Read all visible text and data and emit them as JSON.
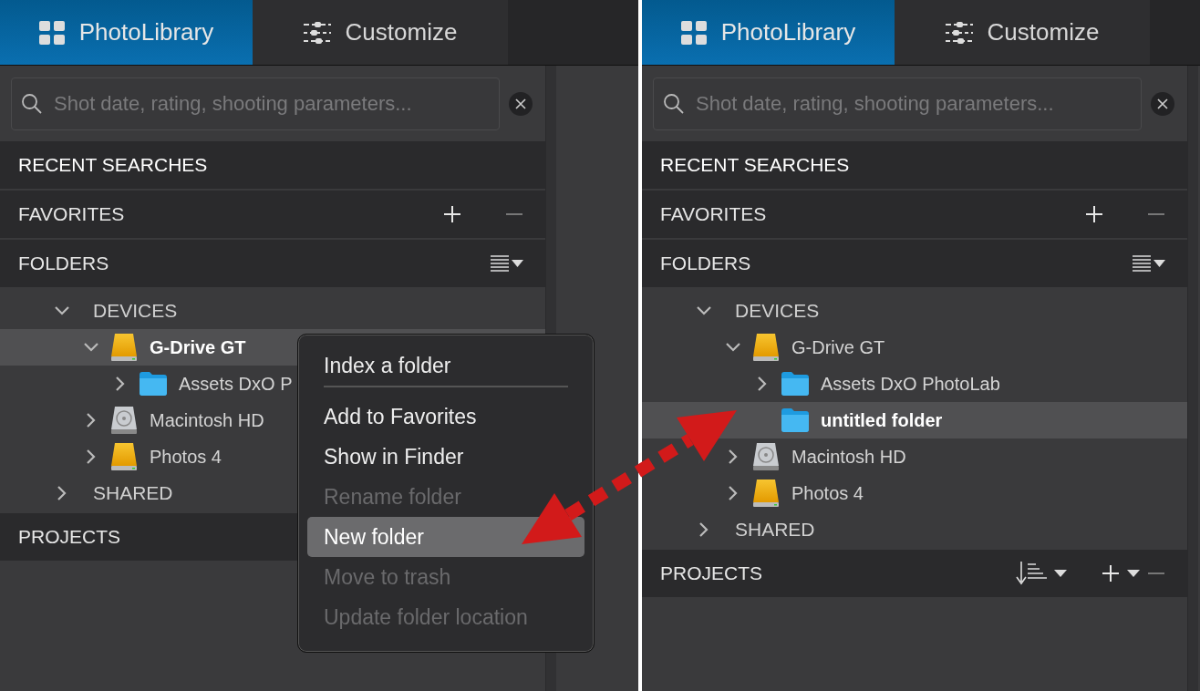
{
  "panels": [
    {
      "tabs": [
        {
          "label": "PhotoLibrary",
          "selected": true
        },
        {
          "label": "Customize",
          "selected": false
        }
      ],
      "search": {
        "placeholder": "Shot date, rating, shooting parameters..."
      },
      "sections": [
        {
          "title": "RECENT SEARCHES",
          "kind": "recent"
        },
        {
          "title": "FAVORITES",
          "kind": "favorites"
        },
        {
          "title": "FOLDERS",
          "kind": "folders"
        }
      ],
      "tree": [
        {
          "label": "DEVICES",
          "kind": "group",
          "expanded": true,
          "selected": false,
          "children": [
            {
              "label": "G-Drive GT",
              "kind": "drive",
              "expanded": true,
              "selected": true,
              "children": [
                {
                  "label": "Assets DxO P",
                  "kind": "folder",
                  "expanded": false,
                  "selected": false
                }
              ]
            },
            {
              "label": "Macintosh HD",
              "kind": "disk",
              "expanded": false,
              "selected": false
            },
            {
              "label": "Photos 4",
              "kind": "drive",
              "expanded": false,
              "selected": false
            }
          ]
        },
        {
          "label": "SHARED",
          "kind": "group",
          "expanded": false,
          "selected": false
        }
      ],
      "projects": {
        "title": "PROJECTS",
        "tools": false
      },
      "context_menu": [
        {
          "kind": "item",
          "label": "Index a folder",
          "disabled": false,
          "selected": false
        },
        {
          "kind": "separator"
        },
        {
          "kind": "item",
          "label": "Add to Favorites",
          "disabled": false,
          "selected": false
        },
        {
          "kind": "item",
          "label": "Show in Finder",
          "disabled": false,
          "selected": false
        },
        {
          "kind": "item",
          "label": "Rename folder",
          "disabled": true,
          "selected": false
        },
        {
          "kind": "item",
          "label": "New folder",
          "disabled": false,
          "selected": true
        },
        {
          "kind": "item",
          "label": "Move to trash",
          "disabled": true,
          "selected": false
        },
        {
          "kind": "item",
          "label": "Update folder location",
          "disabled": true,
          "selected": false
        }
      ]
    },
    {
      "tabs": [
        {
          "label": "PhotoLibrary",
          "selected": true
        },
        {
          "label": "Customize",
          "selected": false
        }
      ],
      "search": {
        "placeholder": "Shot date, rating, shooting parameters..."
      },
      "sections": [
        {
          "title": "RECENT SEARCHES",
          "kind": "recent"
        },
        {
          "title": "FAVORITES",
          "kind": "favorites"
        },
        {
          "title": "FOLDERS",
          "kind": "folders"
        }
      ],
      "tree": [
        {
          "label": "DEVICES",
          "kind": "group",
          "expanded": true,
          "selected": false,
          "children": [
            {
              "label": "G-Drive GT",
              "kind": "drive",
              "expanded": true,
              "selected": false,
              "children": [
                {
                  "label": "Assets DxO PhotoLab",
                  "kind": "folder",
                  "expanded": false,
                  "selected": false
                },
                {
                  "label": "untitled folder",
                  "kind": "folder",
                  "selected": true
                }
              ]
            },
            {
              "label": "Macintosh HD",
              "kind": "disk",
              "expanded": false,
              "selected": false
            },
            {
              "label": "Photos 4",
              "kind": "drive",
              "expanded": false,
              "selected": false
            }
          ]
        },
        {
          "label": "SHARED",
          "kind": "group",
          "expanded": false,
          "selected": false
        }
      ],
      "projects": {
        "title": "PROJECTS",
        "tools": true
      }
    }
  ]
}
